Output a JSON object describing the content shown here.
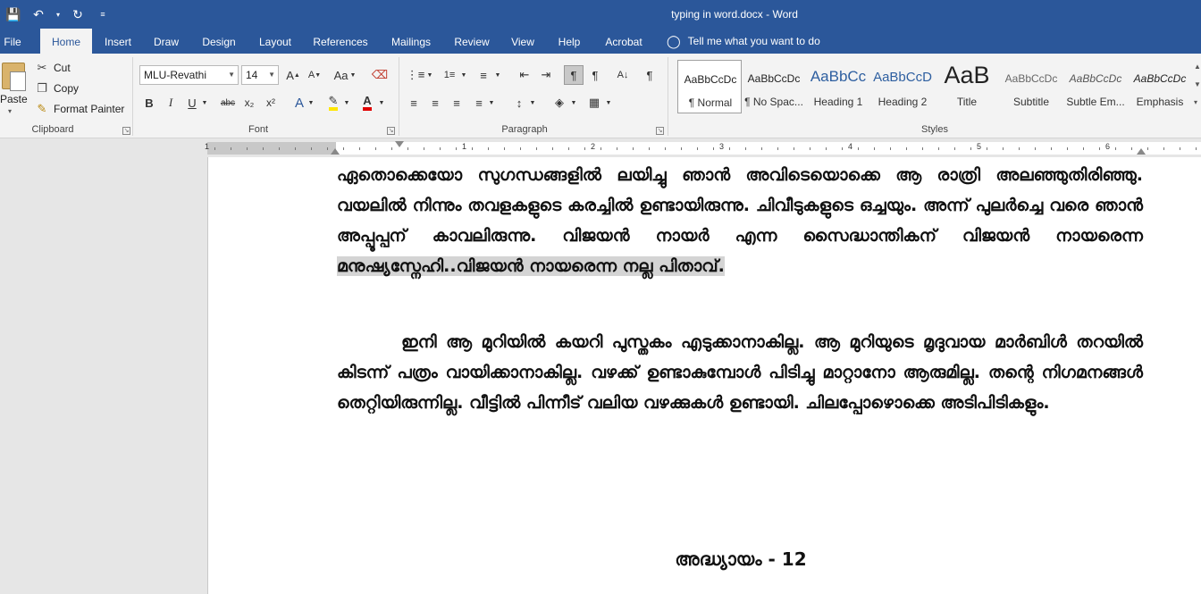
{
  "titlebar": {
    "title": "typing in word.docx  -  Word",
    "qat": [
      "save-icon",
      "undo-icon",
      "redo-icon",
      "customize-icon"
    ]
  },
  "tabs": [
    "File",
    "Home",
    "Insert",
    "Draw",
    "Design",
    "Layout",
    "References",
    "Mailings",
    "Review",
    "View",
    "Help",
    "Acrobat"
  ],
  "active_tab": "Home",
  "tell_me": "Tell me what you want to do",
  "clipboard": {
    "paste": "Paste",
    "cut": "Cut",
    "copy": "Copy",
    "format_painter": "Format Painter",
    "label": "Clipboard"
  },
  "font": {
    "name": "MLU-Revathi",
    "size": "14",
    "label": "Font",
    "bold": "B",
    "italic": "I",
    "underline": "U",
    "strike": "abc",
    "subscript": "x₂",
    "superscript": "x²",
    "grow": "A",
    "shrink": "A",
    "case": "Aa"
  },
  "paragraph": {
    "label": "Paragraph"
  },
  "styles": {
    "label": "Styles",
    "items": [
      {
        "sample": "AaBbCcDc",
        "name": "¶ Normal"
      },
      {
        "sample": "AaBbCcDc",
        "name": "¶ No Spac..."
      },
      {
        "sample": "AaBbCc",
        "name": "Heading 1"
      },
      {
        "sample": "AaBbCcD",
        "name": "Heading 2"
      },
      {
        "sample": "AaB",
        "name": "Title"
      },
      {
        "sample": "AaBbCcDc",
        "name": "Subtitle"
      },
      {
        "sample": "AaBbCcDc",
        "name": "Subtle Em..."
      },
      {
        "sample": "AaBbCcDc",
        "name": "Emphasis"
      }
    ]
  },
  "ruler": {
    "numbers": [
      "1",
      "1",
      "2",
      "3",
      "4",
      "5",
      "6"
    ]
  },
  "document": {
    "para1_main": "ഏതൊക്കെയോ സുഗന്ധങ്ങളിൽ ലയിച്ചു ഞാൻ അവിടെയൊക്കെ ആ രാത്രി അലഞ്ഞുതിരിഞ്ഞു. വയലിൽ നിന്നും തവളകളുടെ കരച്ചിൽ ഉണ്ടായിരുന്നു. ചിവീടുകളുടെ ഒച്ചയും. അന്ന് പുലർച്ചെ വരെ ഞാൻ അപ്പൂപ്പന് കാവലിരുന്നു. വിജയൻ നായർ എന്ന സൈദ്ധാന്തികന് വിജയൻ നായരെന്ന ",
    "para1_highlight": "മനുഷ്യസ്നേഹി..വിജയൻ നായരെന്ന നല്ല പിതാവ്.",
    "para2": "ഇനി ആ മുറിയിൽ കയറി പുസ്തകം എടുക്കാനാകില്ല. ആ മുറിയുടെ മൃദുവായ മാർബിൾ തറയിൽ കിടന്ന് പത്രം വായിക്കാനാകില്ല. വഴക്ക് ഉണ്ടാകുമ്പോൾ പിടിച്ചു മാറ്റാനോ ആരുമില്ല. തന്റെ നിഗമനങ്ങൾ തെറ്റിയിരുന്നില്ല. വീട്ടിൽ പിന്നീട് വലിയ വഴക്കുകൾ ഉണ്ടായി. ചിലപ്പോഴൊക്കെ അടിപിടികളും.",
    "chapter": "അദ്ധ്യായം - 12"
  },
  "colors": {
    "accent": "#2b579a",
    "ribbon": "#f3f3f3",
    "highlight": "#d4d4d4"
  }
}
